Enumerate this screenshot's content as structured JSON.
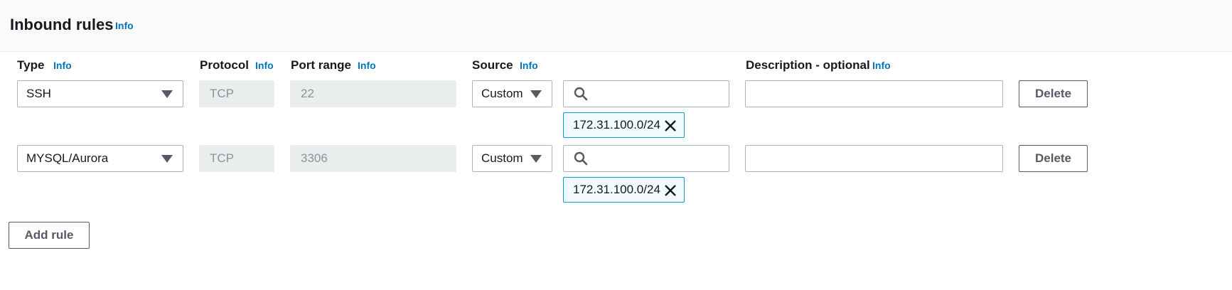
{
  "section": {
    "title": "Inbound rules",
    "info": "Info"
  },
  "columns": {
    "type": "Type",
    "protocol": "Protocol",
    "port_range": "Port range",
    "source": "Source",
    "description": "Description - optional",
    "info": "Info"
  },
  "rules": [
    {
      "type": "SSH",
      "protocol": "TCP",
      "port_range": "22",
      "source_type": "Custom",
      "source_cidr": "172.31.100.0/24",
      "description": "",
      "delete_label": "Delete"
    },
    {
      "type": "MYSQL/Aurora",
      "protocol": "TCP",
      "port_range": "3306",
      "source_type": "Custom",
      "source_cidr": "172.31.100.0/24",
      "description": "",
      "delete_label": "Delete"
    }
  ],
  "add_rule_label": "Add rule",
  "colors": {
    "link": "#0073bb",
    "token_border": "#00a1c9",
    "token_bg": "#f1faff",
    "disabled_bg": "#eaeded"
  },
  "icons": {
    "caret": "caret-down-icon",
    "search": "search-icon",
    "remove": "close-icon"
  }
}
